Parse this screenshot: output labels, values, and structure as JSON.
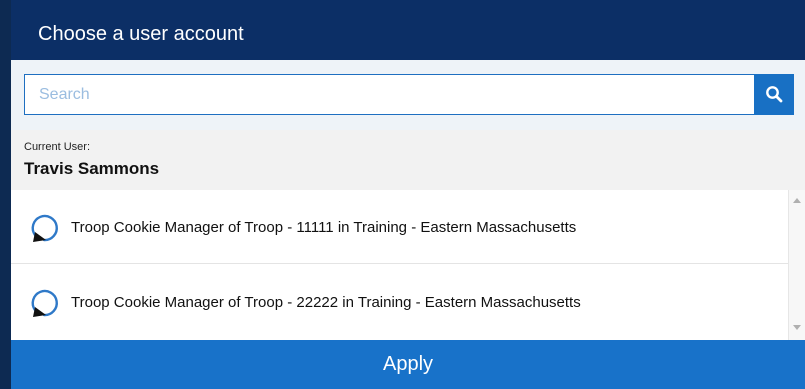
{
  "dialog": {
    "title": "Choose a user account"
  },
  "search": {
    "placeholder": "Search",
    "value": "",
    "button_icon": "search-icon"
  },
  "current_user": {
    "label": "Current User:",
    "name": "Travis Sammons"
  },
  "accounts": [
    {
      "label": "Troop Cookie Manager of Troop - 11111 in Training - Eastern Massachusetts",
      "icon": "radio-unselected-icon"
    },
    {
      "label": "Troop Cookie Manager of Troop - 22222 in Training - Eastern Massachusetts",
      "icon": "radio-unselected-icon"
    }
  ],
  "footer": {
    "apply_label": "Apply"
  },
  "colors": {
    "header_bg": "#0c2f66",
    "accent": "#1872c9",
    "search_border": "#1e6fc1",
    "radio_blue": "#2f79c8"
  }
}
